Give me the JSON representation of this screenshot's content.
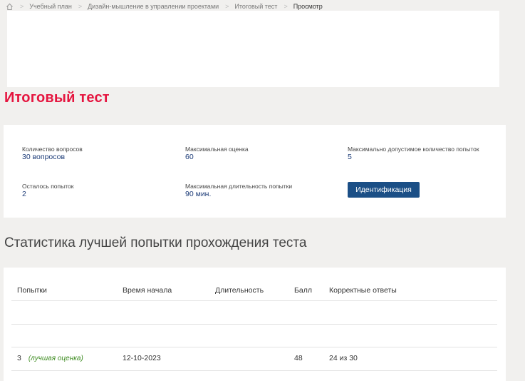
{
  "breadcrumb": {
    "items": [
      "Учебный план",
      "Дизайн-мышление в управлении проектами",
      "Итоговый тест"
    ],
    "current": "Просмотр"
  },
  "page": {
    "title": "Итоговый тест"
  },
  "info": {
    "questions_label": "Количество вопросов",
    "questions_value": "30 вопросов",
    "max_score_label": "Максимальная оценка",
    "max_score_value": "60",
    "max_attempts_label": "Максимально допустимое количество попыток",
    "max_attempts_value": "5",
    "attempts_left_label": "Осталось попыток",
    "attempts_left_value": "2",
    "max_duration_label": "Максимальная длительность попытки",
    "max_duration_value": "90 мин.",
    "identify_button": "Идентификация"
  },
  "stats": {
    "title": "Статистика лучшей попытки прохождения теста",
    "columns": [
      "Попытки",
      "Время начала",
      "Длительность",
      "Балл",
      "Корректные ответы"
    ],
    "row": {
      "attempt": "3",
      "best_note": "(лучшая оценка)",
      "start": "12-10-2023",
      "duration": "",
      "score": "48",
      "correct": "24 из 30"
    }
  },
  "colors": {
    "title": "#e5153f",
    "value": "#1d3c78",
    "button": "#1b4f86",
    "best_note": "#3b8a1e"
  }
}
